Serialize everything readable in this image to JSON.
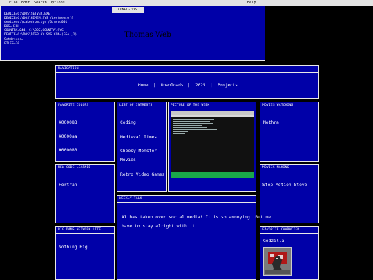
{
  "window": {
    "menu": [
      "File",
      "Edit",
      "Search",
      "Options"
    ],
    "help": "Help",
    "title": "CONFIG.SYS",
    "config_lines": [
      "DEVICE=C:\\DOS\\SETVER.EXE",
      "DEVICE=C:\\DOS\\HIMEM.SYS /testmem:off",
      "device=c:\\cakedrom.sys /D:mscd001",
      "DOS=HIGH",
      "COUNTRY=044,,C:\\DOS\\COUNTRY.SYS",
      "DEVICE=C:\\DOS\\DISPLAY.SYS CON=(EGA,,1)",
      "Setdriver=",
      "FILES=30"
    ],
    "heading": "Thomas Web"
  },
  "navigation": {
    "title": "NAVIGATION",
    "links": [
      "Home",
      "Downloads",
      "2025",
      "Projects"
    ],
    "separator": "|"
  },
  "favorite_colors": {
    "title": "FAVORITE COLORS",
    "items": [
      "#0000BB",
      "#0000aa",
      "#0000BB"
    ]
  },
  "list_of_interests": {
    "title": "LIST OF INTRESTS",
    "items": [
      "Coding",
      "Medieval Times",
      "Cheesy Monster",
      "Movies",
      "Retro Video Games"
    ]
  },
  "picture_of_week": {
    "title": "PICTURE OF THE WEEK"
  },
  "movies_watching": {
    "title": "MOVIES WATCHING",
    "item": "Mothra"
  },
  "new_code_learned": {
    "title": "NEW CODE LEARNED",
    "item": "Fortran"
  },
  "movies_making": {
    "title": "MOVIES MAKING",
    "item": "Stop Motion Steve"
  },
  "weekly_talk": {
    "title": "WEEKLY TALK",
    "lines": [
      "AI has taken over social media! It is so annoying! But me",
      "have to stay alright with it"
    ]
  },
  "big_dams_network_lite": {
    "title": "BIG DAMS NETWORK LITE",
    "item": "Nothing Big"
  },
  "favorite_character": {
    "title": "FAVORITE CHARACTER",
    "item": "Godzilla"
  },
  "colors": {
    "panel": "#0000a8",
    "background": "#000000",
    "border": "#e8e8e8",
    "menubar": "#e4e4e4"
  }
}
